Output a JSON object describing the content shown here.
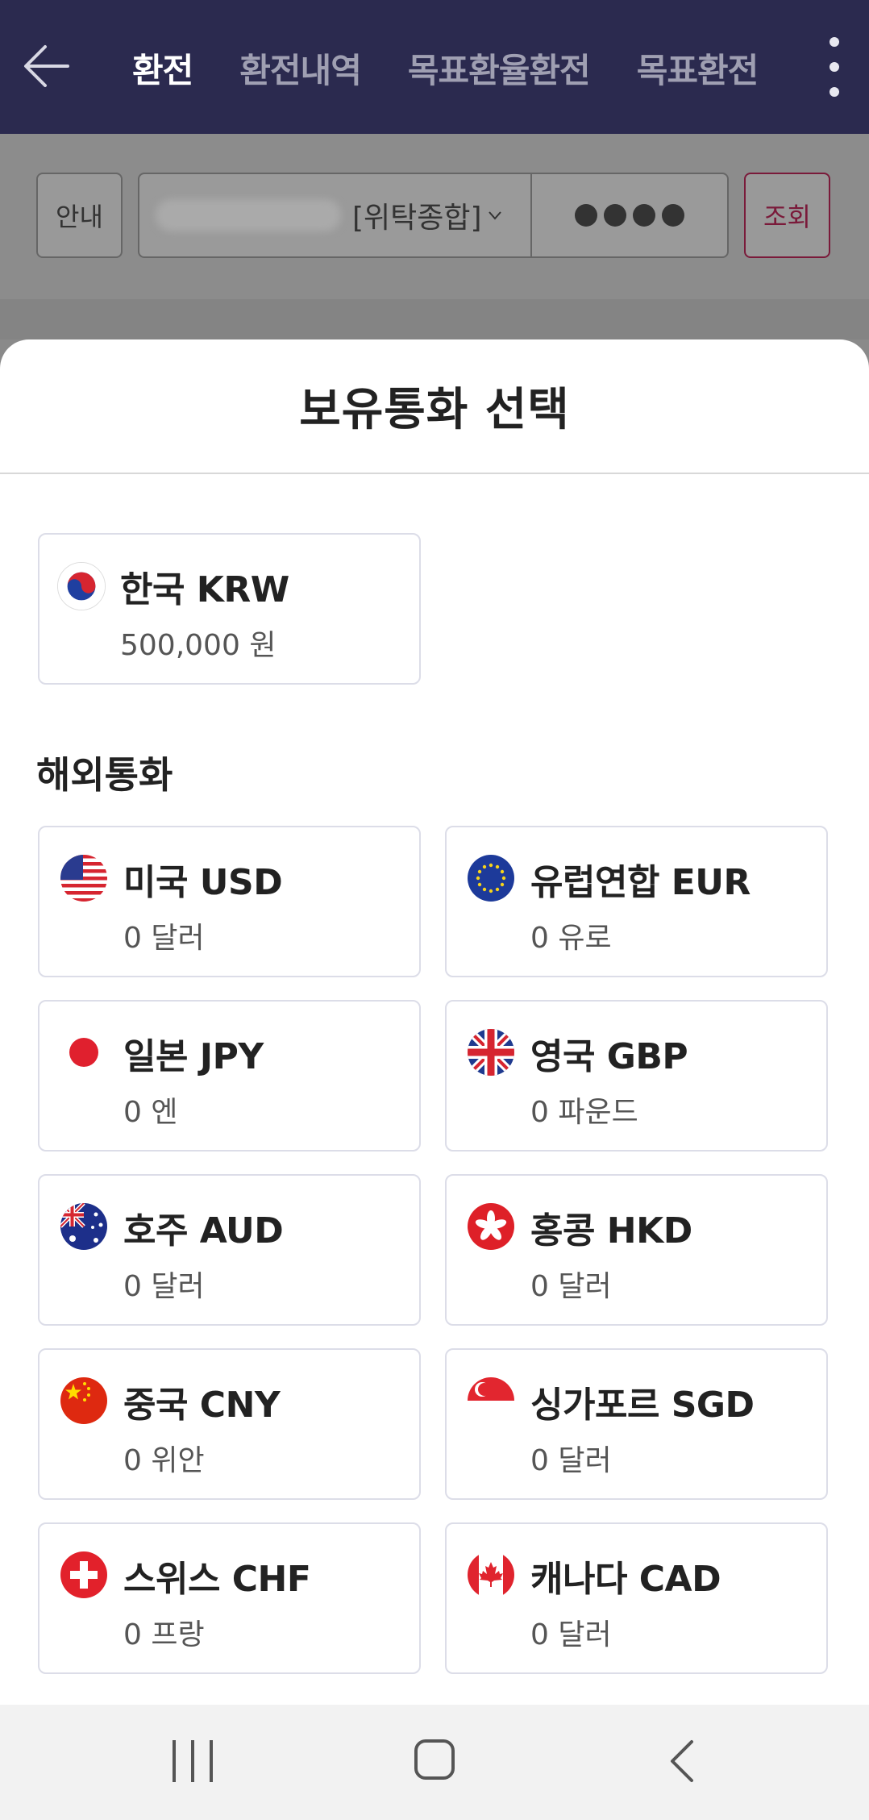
{
  "header": {
    "tabs": [
      {
        "label": "환전",
        "active": true
      },
      {
        "label": "환전내역",
        "active": false
      },
      {
        "label": "목표환율환전",
        "active": false
      },
      {
        "label": "목표환전",
        "active": false
      }
    ]
  },
  "account": {
    "guide_label": "안내",
    "account_type": "[위탁종합]",
    "password_mask": "●●●●",
    "query_label": "조회"
  },
  "sheet": {
    "title": "보유통화 선택",
    "domestic": {
      "name": "한국 KRW",
      "amount": "500,000 원"
    },
    "foreign_title": "해외통화",
    "foreign": [
      {
        "name": "미국 USD",
        "amount": "0 달러",
        "flag": "us-flag-icon"
      },
      {
        "name": "유럽연합 EUR",
        "amount": "0 유로",
        "flag": "eu-flag-icon"
      },
      {
        "name": "일본 JPY",
        "amount": "0 엔",
        "flag": "jp-flag-icon"
      },
      {
        "name": "영국 GBP",
        "amount": "0 파운드",
        "flag": "gb-flag-icon"
      },
      {
        "name": "호주 AUD",
        "amount": "0 달러",
        "flag": "au-flag-icon"
      },
      {
        "name": "홍콩 HKD",
        "amount": "0 달러",
        "flag": "hk-flag-icon"
      },
      {
        "name": "중국 CNY",
        "amount": "0 위안",
        "flag": "cn-flag-icon"
      },
      {
        "name": "싱가포르 SGD",
        "amount": "0 달러",
        "flag": "sg-flag-icon"
      },
      {
        "name": "스위스 CHF",
        "amount": "0 프랑",
        "flag": "ch-flag-icon"
      },
      {
        "name": "캐나다 CAD",
        "amount": "0 달러",
        "flag": "ca-flag-icon"
      }
    ]
  },
  "colors": {
    "header_bg": "#2b2a4f",
    "query_accent": "#7a1a3a",
    "card_border": "#dcdde8"
  }
}
